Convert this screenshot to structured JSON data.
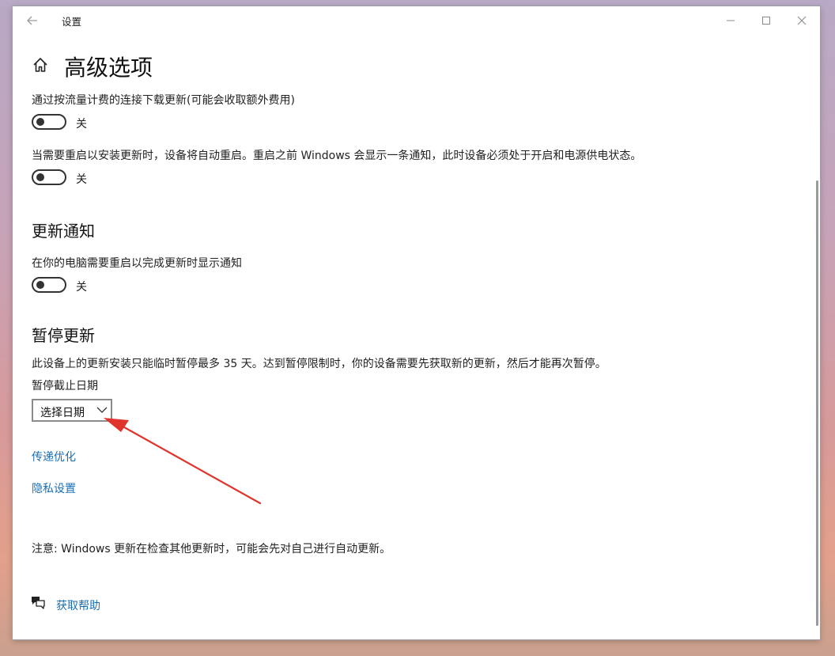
{
  "window": {
    "app_title": "设置",
    "back_icon": "arrow-left-icon",
    "minimize_icon": "minimize-icon",
    "maximize_icon": "maximize-icon",
    "close_icon": "close-icon"
  },
  "page": {
    "title": "高级选项",
    "title_icon": "home-icon"
  },
  "settings": {
    "metered": {
      "label": "通过按流量计费的连接下载更新(可能会收取额外费用)",
      "state": "关",
      "on": false
    },
    "restart": {
      "label": "当需要重启以安装更新时，设备将自动重启。重启之前 Windows 会显示一条通知，此时设备必须处于开启和电源供电状态。",
      "state": "关",
      "on": false
    }
  },
  "update_notifications": {
    "heading": "更新通知",
    "label": "在你的电脑需要重启以完成更新时显示通知",
    "state": "关",
    "on": false
  },
  "pause_updates": {
    "heading": "暂停更新",
    "description": "此设备上的更新安装只能临时暂停最多 35 天。达到暂停限制时，你的设备需要先获取新的更新，然后才能再次暂停。",
    "date_label": "暂停截止日期",
    "dropdown_value": "选择日期",
    "dropdown_icon": "chevron-down-icon"
  },
  "links": {
    "delivery_optimization": "传递优化",
    "privacy_settings": "隐私设置"
  },
  "note": "注意: Windows 更新在检查其他更新时，可能会先对自己进行自动更新。",
  "help": {
    "label": "获取帮助",
    "icon": "chat-help-icon"
  },
  "colors": {
    "link": "#1a6fb3",
    "annotation_arrow": "#e0332b"
  }
}
